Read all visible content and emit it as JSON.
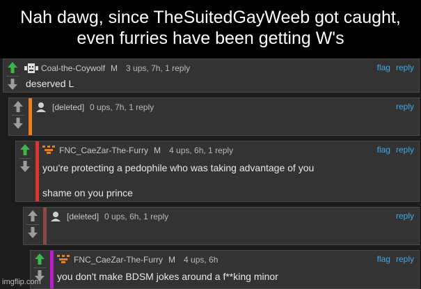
{
  "caption": "Nah dawg, since TheSuitedGayWeeb got caught, even furries have been getting W's",
  "watermark": "imgflip.com",
  "colors": {
    "upvote": "#3cb54a",
    "arrow_gray": "#9c9c9c",
    "link": "#3fa9e6"
  },
  "comments": [
    {
      "user": "Coal-the-Coywolf",
      "badge": "M",
      "meta": "3 ups, 7h, 1 reply",
      "flag": "flag",
      "reply": "reply",
      "lines": [
        "deserved L"
      ],
      "bar_color": "",
      "upvoted": true,
      "avatar": "robot-avatar-icon"
    },
    {
      "user": "[deleted]",
      "badge": "",
      "meta": "0 ups, 7h, 1 reply",
      "flag": "",
      "reply": "reply",
      "lines": [],
      "bar_color": "#f07e17",
      "upvoted": false,
      "avatar": "default-user-icon"
    },
    {
      "user": "FNC_CaeZar-The-Furry",
      "badge": "M",
      "meta": "4 ups, 6h, 1 reply",
      "flag": "flag",
      "reply": "reply",
      "lines": [
        "you're protecting a pedophile who was taking advantage of you",
        "shame on you prince"
      ],
      "bar_color": "#e03434",
      "upvoted": true,
      "avatar": "fox-pixel-avatar-icon"
    },
    {
      "user": "[deleted]",
      "badge": "",
      "meta": "0 ups, 6h, 1 reply",
      "flag": "",
      "reply": "reply",
      "lines": [],
      "bar_color": "#8c4848",
      "upvoted": false,
      "avatar": "default-user-icon"
    },
    {
      "user": "FNC_CaeZar-The-Furry",
      "badge": "M",
      "meta": "4 ups, 6h",
      "flag": "flag",
      "reply": "reply",
      "lines": [
        "you don't make BDSM jokes around a f**king minor"
      ],
      "bar_color": "#c11ad4",
      "upvoted": true,
      "avatar": "fox-pixel-avatar-icon"
    }
  ]
}
